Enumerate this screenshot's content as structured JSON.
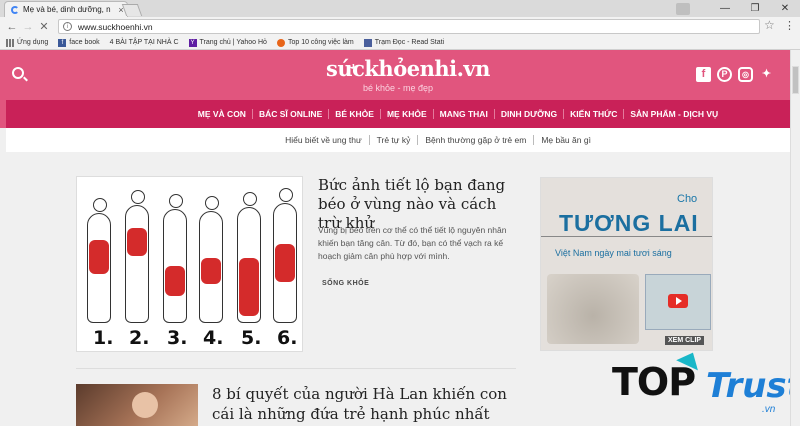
{
  "browser": {
    "tab_title": "Mẹ và bé, dinh dưỡng, n",
    "tab_close": "×",
    "window_controls": [
      "—",
      "❐",
      "✕"
    ],
    "url": "www.suckhoenhi.vn",
    "nav": {
      "back": "←",
      "forward": "→",
      "reload": "✕"
    },
    "star": "☆",
    "menu": "⋮"
  },
  "bookmarks": [
    {
      "label": "Ứng dụng",
      "icon": "apps-grid-icon"
    },
    {
      "label": "face book",
      "icon": "facebook-icon"
    },
    {
      "label": "4 BÀI TẬP TẠI NHÀ C",
      "icon": "none"
    },
    {
      "label": "Trang chủ | Yahoo Hỏ",
      "icon": "yahoo-icon"
    },
    {
      "label": "Top 10 công việc làm",
      "icon": "gear-flower-icon"
    },
    {
      "label": "Trạm Đọc - Read Stati",
      "icon": "bookmark-icon"
    }
  ],
  "site": {
    "logo": "sứckhỏenhi.vn",
    "tagline": "bé khỏe - mẹ đẹp",
    "social": [
      "f",
      "P",
      "◎",
      "🐦"
    ],
    "main_nav": [
      "MẸ VÀ CON",
      "BÁC SĨ ONLINE",
      "BÉ KHỎE",
      "MẸ KHỎE",
      "MANG THAI",
      "DINH DƯỠNG",
      "KIẾN THỨC",
      "SẢN PHẨM - DỊCH VỤ"
    ],
    "sub_nav": [
      "Hiểu biết về ung thư",
      "Trẻ tự kỷ",
      "Bệnh thường gặp ở trẻ em",
      "Mẹ bầu ăn gì"
    ]
  },
  "articles": [
    {
      "title": "Bức ảnh tiết lộ bạn đang béo ở vùng nào và cách trừ khử",
      "description": "Vùng bị béo trên cơ thể có thể tiết lộ nguyên nhân khiến bạn tăng cân. Từ đó, bạn có thể vạch ra kế hoạch giảm cân phù hợp với mình.",
      "category": "SỐNG KHỎE",
      "figure_numbers": [
        "1.",
        "2.",
        "3.",
        "4.",
        "5.",
        "6."
      ]
    },
    {
      "title": "8 bí quyết của người Hà Lan khiến con cái là những đứa trẻ hạnh phúc nhất"
    }
  ],
  "ad": {
    "top": "Cho",
    "headline": "TƯƠNG LAI",
    "subline": "Việt Nam ngày mai tươi sáng",
    "button": "XEM CLIP"
  },
  "watermark": {
    "part1": "TOP",
    "part2": "Trust",
    "domain": ".vn"
  }
}
